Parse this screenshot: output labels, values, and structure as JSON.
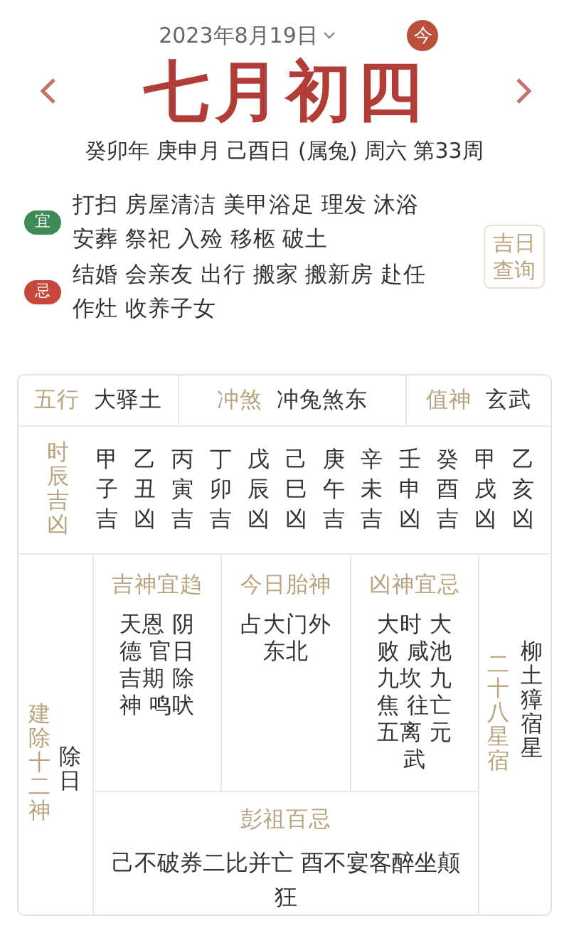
{
  "header": {
    "date": "2023年8月19日",
    "today_badge": "今",
    "lunar_date": "七月初四",
    "ganzhi": "癸卯年 庚申月 己酉日 (属兔) 周六 第33周"
  },
  "yi_ji": [
    {
      "badge": "宜",
      "color": "#3d8a55",
      "lines": [
        "打扫 房屋清洁 美甲浴足 理发 沐浴",
        "安葬 祭祀 入殓 移柩 破土"
      ]
    },
    {
      "badge": "忌",
      "color": "#c8453c",
      "lines": [
        "结婚 会亲友 出行 搬家 搬新房 赴任",
        "作灶 收养子女"
      ]
    }
  ],
  "lucky_day_button": "吉日查询",
  "info_row": [
    {
      "label": "五行",
      "value": "大驿土"
    },
    {
      "label": "冲煞",
      "value": "冲兔煞东"
    },
    {
      "label": "值神",
      "value": "玄武"
    }
  ],
  "hours": {
    "label": "时辰吉凶",
    "columns": [
      {
        "stem": "甲",
        "branch": "子",
        "fortune": "吉"
      },
      {
        "stem": "乙",
        "branch": "丑",
        "fortune": "凶"
      },
      {
        "stem": "丙",
        "branch": "寅",
        "fortune": "吉"
      },
      {
        "stem": "丁",
        "branch": "卯",
        "fortune": "吉"
      },
      {
        "stem": "戊",
        "branch": "辰",
        "fortune": "凶"
      },
      {
        "stem": "己",
        "branch": "巳",
        "fortune": "凶"
      },
      {
        "stem": "庚",
        "branch": "午",
        "fortune": "吉"
      },
      {
        "stem": "辛",
        "branch": "未",
        "fortune": "吉"
      },
      {
        "stem": "壬",
        "branch": "申",
        "fortune": "凶"
      },
      {
        "stem": "癸",
        "branch": "酉",
        "fortune": "吉"
      },
      {
        "stem": "甲",
        "branch": "戌",
        "fortune": "凶"
      },
      {
        "stem": "乙",
        "branch": "亥",
        "fortune": "凶"
      }
    ]
  },
  "duty": {
    "label": "建除十二神",
    "value": "除日"
  },
  "gods": [
    {
      "title": "吉神宜趋",
      "lines": [
        "天恩 阴",
        "德 官日",
        "吉期 除",
        "神 鸣吠"
      ]
    },
    {
      "title": "今日胎神",
      "lines": [
        "占大门外",
        "东北"
      ]
    },
    {
      "title": "凶神宜忌",
      "lines": [
        "大时 大",
        "败 咸池",
        "九坎 九",
        "焦 往亡",
        "五离 元",
        "武"
      ]
    }
  ],
  "pengzu": {
    "title": "彭祖百忌",
    "lines": [
      "己不破券二比并亡 酉不宴客醉坐颠",
      "狂"
    ]
  },
  "stars": {
    "label": "二十八星宿",
    "value": "柳土獐宿星"
  }
}
